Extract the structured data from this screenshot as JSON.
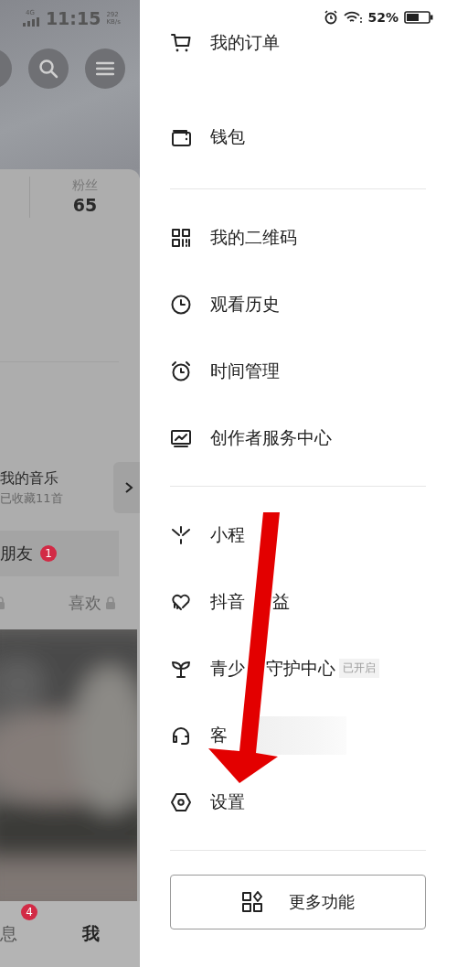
{
  "background_page": {
    "status_bar": {
      "network": "4G",
      "time": "11:15",
      "speed_value": "292",
      "speed_unit": "KB/s"
    },
    "stats": [
      {
        "label": "粉丝",
        "value": "65"
      }
    ],
    "music": {
      "title": "我的音乐",
      "subtitle": "已收藏11首"
    },
    "friends": {
      "label": "朋友",
      "badge": "1"
    },
    "tabs": [
      {
        "locked": true
      },
      {
        "label": "喜欢",
        "locked": true
      }
    ],
    "bottom_nav": [
      {
        "label": "息",
        "badge": "4",
        "selected": false
      },
      {
        "label": "我",
        "selected": true
      }
    ]
  },
  "drawer": {
    "status_bar": {
      "battery": "52%"
    },
    "groups": [
      {
        "items": [
          {
            "label_parts": [
              "我的订单"
            ]
          },
          {
            "label_parts": [
              "钱包"
            ]
          }
        ]
      },
      {
        "items": [
          {
            "label_parts": [
              "我的二维码"
            ]
          },
          {
            "label_parts": [
              "观看历史"
            ]
          },
          {
            "label_parts": [
              "时间管理"
            ]
          },
          {
            "label_parts": [
              "创作者服务中心"
            ]
          }
        ]
      },
      {
        "items": [
          {
            "label_parts": [
              "小程"
            ]
          },
          {
            "label_parts": [
              "抖音",
              "益"
            ]
          },
          {
            "label_parts": [
              "青少",
              "守护中心"
            ],
            "tag": "已开启"
          },
          {
            "label_parts": [
              "客"
            ],
            "redacted": true
          },
          {
            "label_parts": [
              "设置"
            ]
          }
        ]
      }
    ],
    "more_button": {
      "label": "更多功能"
    }
  },
  "annotation": {
    "color": "#e30000"
  }
}
